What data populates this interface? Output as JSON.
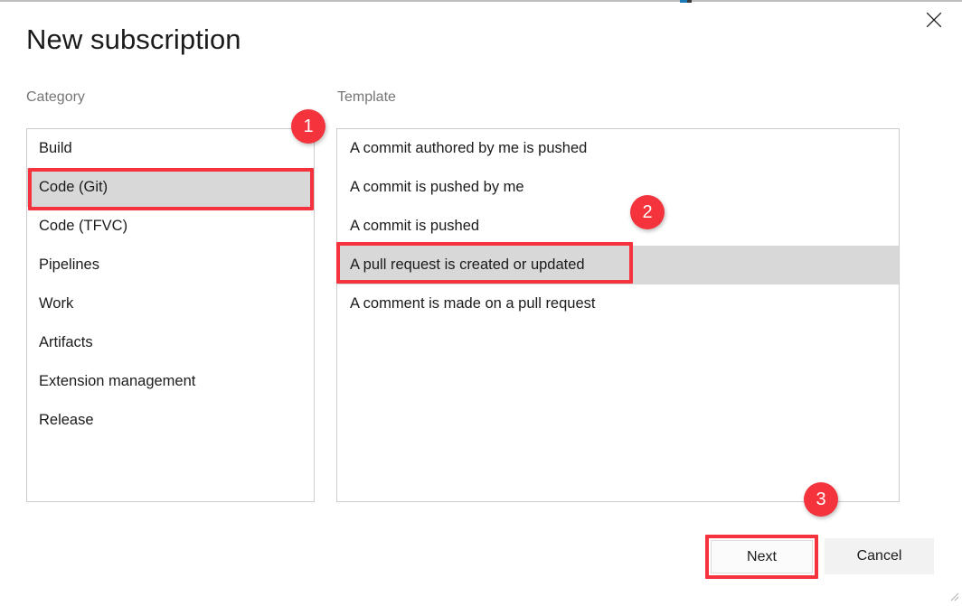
{
  "dialog": {
    "title": "New subscription",
    "close_icon": "close-icon"
  },
  "labels": {
    "category": "Category",
    "template": "Template"
  },
  "category_list": {
    "selected": "Code (Git)",
    "items": [
      {
        "label": "Build",
        "selected": false
      },
      {
        "label": "Code (Git)",
        "selected": true
      },
      {
        "label": "Code (TFVC)",
        "selected": false
      },
      {
        "label": "Pipelines",
        "selected": false
      },
      {
        "label": "Work",
        "selected": false
      },
      {
        "label": "Artifacts",
        "selected": false
      },
      {
        "label": "Extension management",
        "selected": false
      },
      {
        "label": "Release",
        "selected": false
      }
    ]
  },
  "template_list": {
    "selected": "A pull request is created or updated",
    "items": [
      {
        "label": "A commit authored by me is pushed",
        "selected": false
      },
      {
        "label": "A commit is pushed by me",
        "selected": false
      },
      {
        "label": "A commit is pushed",
        "selected": false
      },
      {
        "label": "A pull request is created or updated",
        "selected": true
      },
      {
        "label": "A comment is made on a pull request",
        "selected": false
      }
    ]
  },
  "footer": {
    "next_label": "Next",
    "cancel_label": "Cancel"
  },
  "annotations": {
    "color": "#f4333d",
    "badges": [
      {
        "number": "1",
        "target": "category-item-code-git"
      },
      {
        "number": "2",
        "target": "template-item-pull-request"
      },
      {
        "number": "3",
        "target": "next-button"
      }
    ]
  },
  "colors": {
    "selection_gray": "#d8d8d8",
    "border_gray": "#cccccc",
    "annotation_red": "#f4333d",
    "cancel_button_bg": "#f2f2f2"
  }
}
